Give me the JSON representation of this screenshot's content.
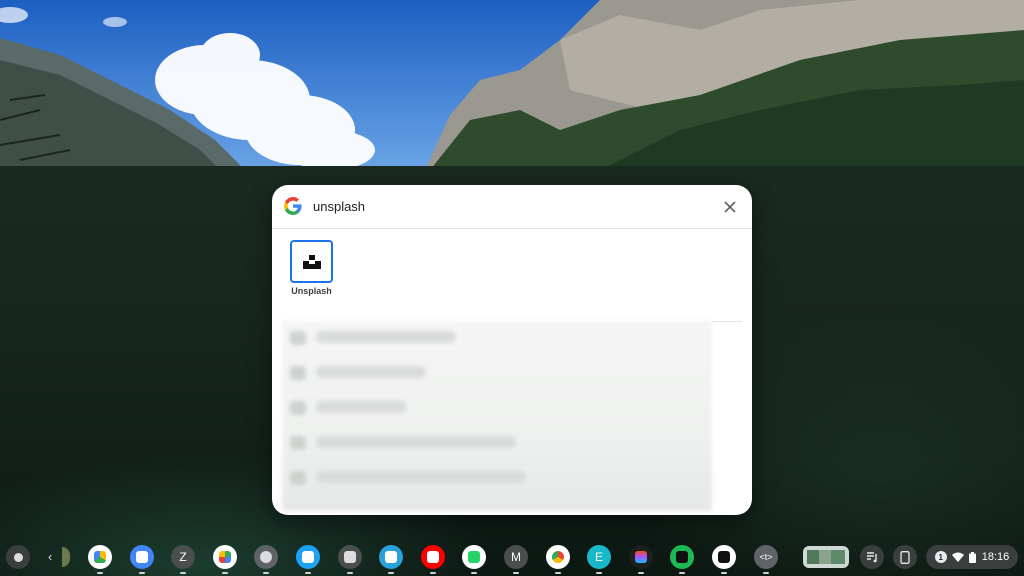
{
  "search": {
    "query": "unsplash"
  },
  "result": {
    "label": "Unsplash",
    "icon": "unsplash-icon"
  },
  "shelf": {
    "apps": [
      {
        "icon": "drive-icon",
        "color": "#ffffff"
      },
      {
        "icon": "docs-icon",
        "color": "#4285f4"
      },
      {
        "icon": "zoom-app-icon",
        "color": "#4a4e4c",
        "text": "Z"
      },
      {
        "icon": "play-store-icon",
        "color": "#ffffff"
      },
      {
        "icon": "settings-icon",
        "color": "#5f6368"
      },
      {
        "icon": "twitter-icon",
        "color": "#1da1f2"
      },
      {
        "icon": "terminal-icon",
        "color": "#4a4e4c"
      },
      {
        "icon": "telegram-icon",
        "color": "#2aa1da"
      },
      {
        "icon": "youtube-icon",
        "color": "#ff0000"
      },
      {
        "icon": "whatsapp-icon",
        "color": "#ffffff"
      },
      {
        "icon": "m-app-icon",
        "color": "#4a4e4c",
        "text": "M"
      },
      {
        "icon": "chrome-icon",
        "color": "#ffffff"
      },
      {
        "icon": "e-app-icon",
        "color": "#19b8c9",
        "text": "E"
      },
      {
        "icon": "figma-icon",
        "color": "#1e1e1e"
      },
      {
        "icon": "spotify-icon",
        "color": "#1db954"
      },
      {
        "icon": "unsplash-shelf-icon",
        "color": "#ffffff"
      },
      {
        "icon": "code-app-icon",
        "color": "#5f6368",
        "text": "<t>"
      }
    ],
    "status": {
      "notification_count": "1",
      "time": "18:16"
    }
  }
}
